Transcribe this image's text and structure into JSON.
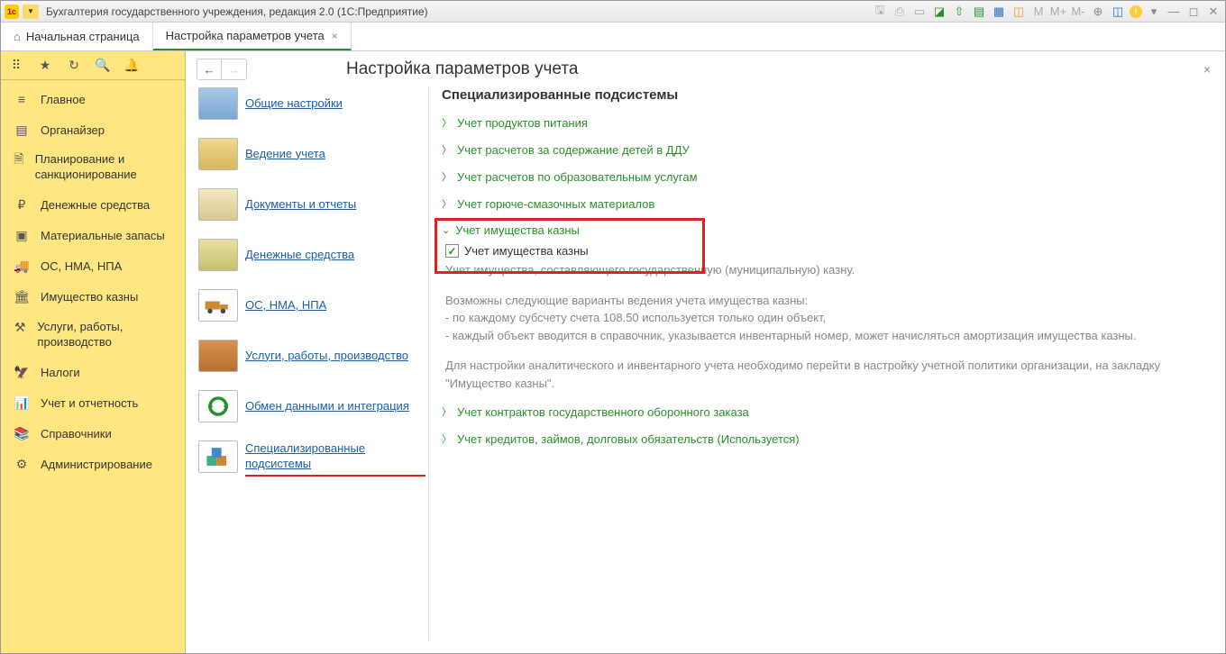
{
  "title_bar": {
    "text": "Бухгалтерия государственного учреждения, редакция 2.0  (1С:Предприятие)",
    "m_labels": [
      "M",
      "M+",
      "M-"
    ]
  },
  "tabs": {
    "home": "Начальная страница",
    "active": "Настройка параметров учета"
  },
  "sidebar": {
    "items": [
      "Главное",
      "Органайзер",
      "Планирование и санкционирование",
      "Денежные средства",
      "Материальные запасы",
      "ОС, НМА, НПА",
      "Имущество казны",
      "Услуги, работы, производство",
      "Налоги",
      "Учет и отчетность",
      "Справочники",
      "Администрирование"
    ]
  },
  "page": {
    "title": "Настройка параметров учета"
  },
  "settings_nav": [
    "Общие настройки",
    "Ведение учета",
    "Документы и отчеты",
    "Денежные средства",
    "ОС, НМА, НПА",
    "Услуги, работы, производство",
    "Обмен данными и интеграция",
    "Специализированные подсистемы"
  ],
  "detail": {
    "heading": "Специализированные подсистемы",
    "items": [
      "Учет продуктов питания",
      "Учет расчетов за содержание детей в ДДУ",
      "Учет расчетов по образовательным услугам",
      "Учет горюче-смазочных материалов",
      "Учет имущества казны",
      "Учет контрактов государственного оборонного заказа",
      "Учет кредитов, займов, долговых обязательств (Используется)"
    ],
    "expanded": {
      "checkbox_label": "Учет имущества казны",
      "desc1": "Учет имущества, составляющего государственную (муниципальную) казну.",
      "desc2": "Возможны следующие варианты ведения учета имущества казны:",
      "desc3": "- по каждому субсчету счета 108.50 используется только один объект,",
      "desc4": "- каждый объект вводится в справочник, указывается инвентарный номер, может начисляться амортизация имущества казны.",
      "desc5": "Для настройки аналитического и инвентарного учета необходимо перейти в настройку учетной политики организации, на закладку \"Имущество казны\"."
    }
  }
}
